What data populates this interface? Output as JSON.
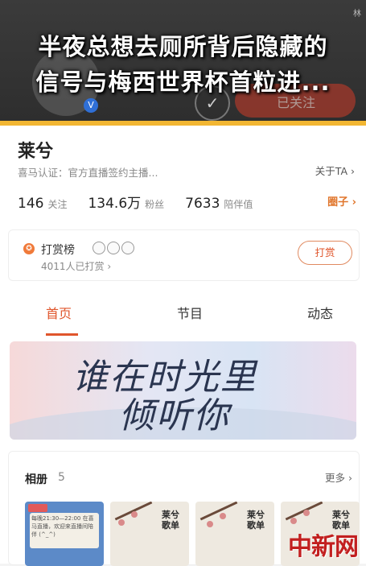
{
  "headline": {
    "line1": "半夜总想去厕所背后隐藏的",
    "line2": "信号与梅西世界杯首粒进..."
  },
  "topbar": {
    "verified_badge": "V",
    "check_symbol": "✓",
    "follow_ghost_label": "已关注",
    "corner_text": "林"
  },
  "profile": {
    "name": "莱兮",
    "certification": "喜马认证：官方直播签约主播...",
    "about_link": "关于TA ›",
    "stats": [
      {
        "num": "146",
        "label": "关注"
      },
      {
        "num": "134.6万",
        "label": "粉丝"
      },
      {
        "num": "7633",
        "label": "陪伴值"
      }
    ],
    "circle_link": "圈子 ›"
  },
  "gift": {
    "icon": "✪",
    "title": "打赏榜",
    "subtitle": "4011人已打赏 ›",
    "button": "打赏"
  },
  "tabs": [
    "首页",
    "节目",
    "动态"
  ],
  "banner": {
    "line1": "谁在时光里",
    "line2": "倾听你"
  },
  "album": {
    "title": "相册",
    "count": "5",
    "more": "更多 ›",
    "thumb1_text": "每晚21:30—22:00 在喜马直播，欢迎来直播间陪伴 (^_^)",
    "painting_text": "莱兮歌单"
  },
  "watermark": "中新网",
  "colors": {
    "accent": "#e0562c",
    "highlight": "#f2b632",
    "verified": "#2f6fd6"
  }
}
